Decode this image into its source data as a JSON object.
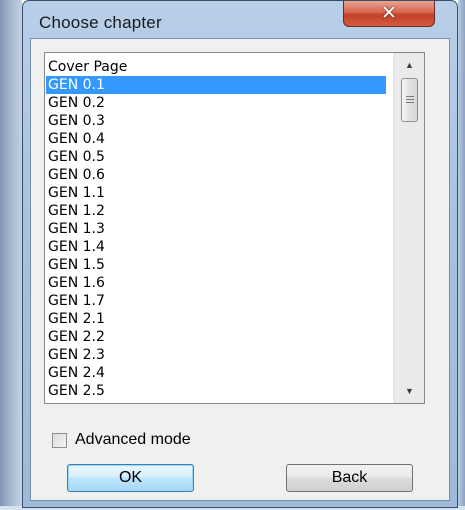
{
  "window": {
    "title": "Choose chapter",
    "close_glyph": "✕"
  },
  "chapters": {
    "selected_index": 1,
    "items": [
      "Cover Page",
      "GEN 0.1",
      "GEN 0.2",
      "GEN 0.3",
      "GEN 0.4",
      "GEN 0.5",
      "GEN 0.6",
      "GEN 1.1",
      "GEN 1.2",
      "GEN 1.3",
      "GEN 1.4",
      "GEN 1.5",
      "GEN 1.6",
      "GEN 1.7",
      "GEN 2.1",
      "GEN 2.2",
      "GEN 2.3",
      "GEN 2.4",
      "GEN 2.5"
    ]
  },
  "scrollbar": {
    "up_glyph": "▲",
    "down_glyph": "▼"
  },
  "advanced_mode": {
    "label": "Advanced mode",
    "checked": false
  },
  "buttons": {
    "ok_label": "OK",
    "back_label": "Back"
  },
  "colors": {
    "selection": "#3399ff",
    "close_button": "#c4402a",
    "default_button_border": "#3c7fb1"
  }
}
